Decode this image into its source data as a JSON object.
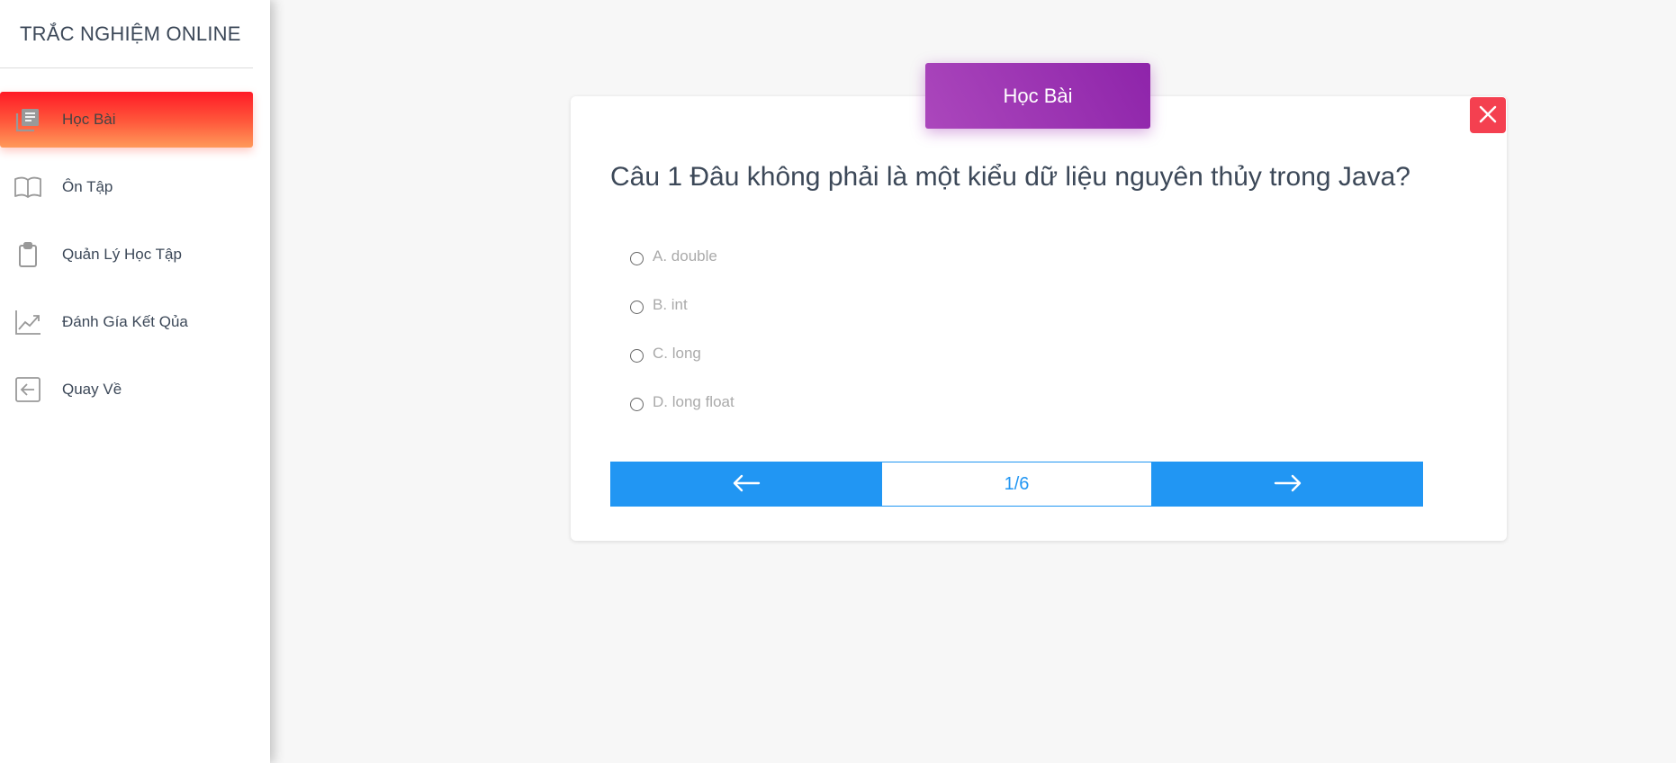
{
  "brand": {
    "title": "TRẮC NGHIỆM ONLINE"
  },
  "sidebar": {
    "items": [
      {
        "label": "Học Bài",
        "icon": "library-books-icon",
        "active": true
      },
      {
        "label": "Ôn Tập",
        "icon": "book-open-icon",
        "active": false
      },
      {
        "label": "Quản Lý Học Tập",
        "icon": "clipboard-icon",
        "active": false
      },
      {
        "label": "Đánh Gía Kết Qủa",
        "icon": "trending-up-icon",
        "active": false
      },
      {
        "label": "Quay Về",
        "icon": "logout-arrow-icon",
        "active": false
      }
    ]
  },
  "card": {
    "header": "Học Bài",
    "question": "Câu 1 Đâu không phải là một kiểu dữ liệu nguyên thủy trong Java?",
    "options": [
      {
        "label": "A. double"
      },
      {
        "label": "B. int"
      },
      {
        "label": "C. long"
      },
      {
        "label": "D. long float"
      }
    ],
    "pager": {
      "count": "1/6",
      "prev_icon": "arrow-left-icon",
      "next_icon": "arrow-right-icon"
    },
    "close_icon": "close-icon"
  },
  "colors": {
    "accent_active_start": "#ff1a26",
    "accent_active_end": "#ff9a5a",
    "header_purple": "#9c27b0",
    "close_red": "#f44050",
    "pager_blue": "#2196f3"
  }
}
